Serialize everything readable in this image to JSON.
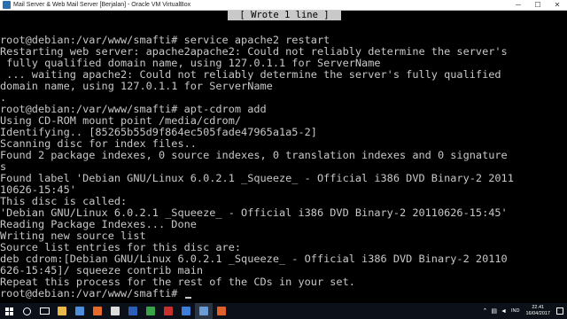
{
  "window": {
    "title": "Mail Server & Web Mail Server [Berjalan] - Oracle VM VirtualBox",
    "controls": {
      "minimize": "─",
      "maximize": "☐",
      "close": "✕"
    }
  },
  "terminal": {
    "status_line": "[ Wrote 1 line ]",
    "lines": [
      "root@debian:/var/www/smafti# service apache2 restart",
      "Restarting web server: apache2apache2: Could not reliably determine the server's",
      " fully qualified domain name, using 127.0.1.1 for ServerName",
      " ... waiting apache2: Could not reliably determine the server's fully qualified",
      "domain name, using 127.0.1.1 for ServerName",
      ".",
      "root@debian:/var/www/smafti# apt-cdrom add",
      "Using CD-ROM mount point /media/cdrom/",
      "Identifying.. [85265b55d9f864ec505fade47965a1a5-2]",
      "Scanning disc for index files..",
      "Found 2 package indexes, 0 source indexes, 0 translation indexes and 0 signature",
      "s",
      "Found label 'Debian GNU/Linux 6.0.2.1 _Squeeze_ - Official i386 DVD Binary-2 2011",
      "10626-15:45'",
      "This disc is called:",
      "'Debian GNU/Linux 6.0.2.1 _Squeeze_ - Official i386 DVD Binary-2 20110626-15:45'",
      "Reading Package Indexes... Done",
      "Writing new source list",
      "Source list entries for this disc are:",
      "deb cdrom:[Debian GNU/Linux 6.0.2.1 _Squeeze_ - Official i386 DVD Binary-2 20110",
      "626-15:45]/ squeeze contrib main",
      "Repeat this process for the rest of the CDs in your set.",
      "root@debian:/var/www/smafti# "
    ]
  },
  "taskbar": {
    "apps": [
      {
        "name": "file-explorer-icon",
        "color": "#e8b84a"
      },
      {
        "name": "store-icon",
        "color": "#4c8ed9"
      },
      {
        "name": "firefox-icon",
        "color": "#e66a2c"
      },
      {
        "name": "chrome-icon",
        "color": "#dcdcdc"
      },
      {
        "name": "word-icon",
        "color": "#2b5fb8"
      },
      {
        "name": "green-app-icon",
        "color": "#3aa34a"
      },
      {
        "name": "filezilla-icon",
        "color": "#c8302c"
      },
      {
        "name": "blue-app-icon",
        "color": "#3b7dd8"
      },
      {
        "name": "virtualbox-icon",
        "color": "#6a9bd6"
      },
      {
        "name": "orange-app-icon",
        "color": "#e0602c"
      }
    ],
    "active_app_index": 8,
    "tray": {
      "language": "IND",
      "time": "22.41",
      "date": "16/04/2017"
    }
  },
  "colors": {
    "terminal_bg": "#000000",
    "terminal_fg": "#c8c8c8",
    "status_bg": "#c9c9c9"
  }
}
